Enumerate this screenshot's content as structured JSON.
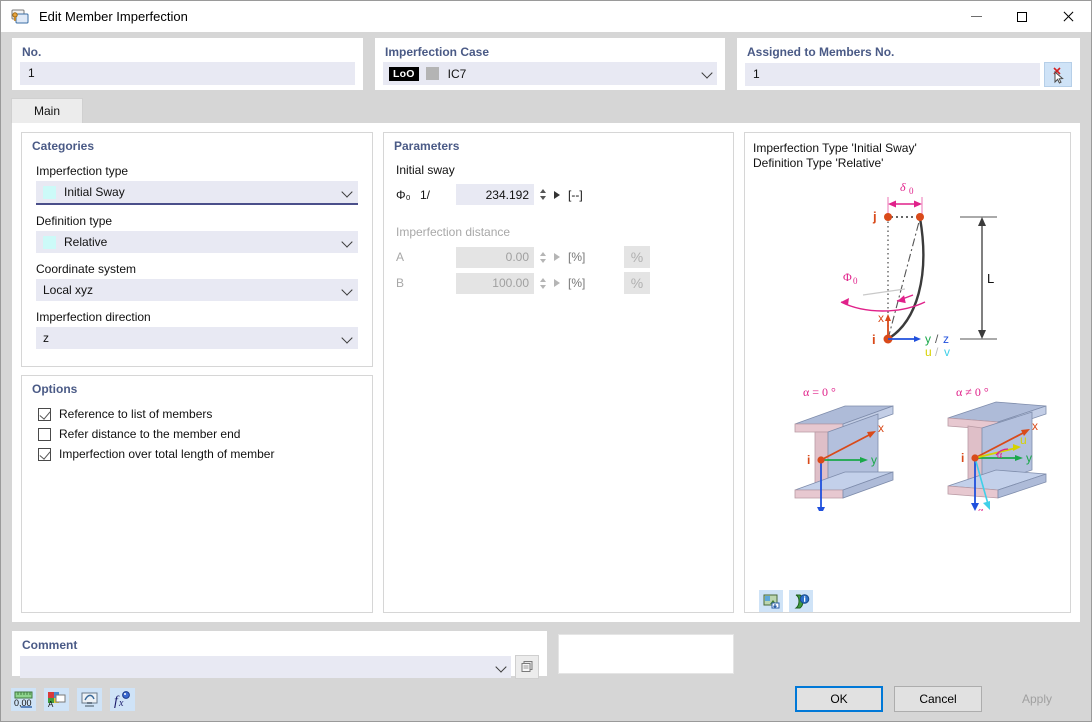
{
  "window": {
    "title": "Edit Member Imperfection",
    "icon": "member-imperfection-icon",
    "minimize": "minimize-icon",
    "maximize": "maximize-icon",
    "close": "close-icon"
  },
  "top": {
    "no": {
      "title": "No.",
      "value": "1"
    },
    "case": {
      "title": "Imperfection Case",
      "badge": "LoO",
      "swatch_color": "#b4b4b4",
      "value": "IC7"
    },
    "assigned": {
      "title": "Assigned to Members No.",
      "value": "1",
      "pick_button": "pick-members-icon"
    }
  },
  "tabs": [
    {
      "label": "Main",
      "active": true
    }
  ],
  "categories": {
    "title": "Categories",
    "fields": [
      {
        "label": "Imperfection type",
        "value": "Initial Sway",
        "swatch": "#ccfaf8",
        "has_swatch": true,
        "focused": true
      },
      {
        "label": "Definition type",
        "value": "Relative",
        "swatch": "#ccfaf8",
        "has_swatch": true,
        "focused": false
      },
      {
        "label": "Coordinate system",
        "value": "Local xyz",
        "has_swatch": false,
        "focused": false
      },
      {
        "label": "Imperfection direction",
        "value": "z",
        "has_swatch": false,
        "focused": false
      }
    ]
  },
  "options": {
    "title": "Options",
    "items": [
      {
        "label": "Reference to list of members",
        "checked": true
      },
      {
        "label": "Refer distance to the member end",
        "checked": false
      },
      {
        "label": "Imperfection over total length of member",
        "checked": true
      }
    ]
  },
  "parameters": {
    "title": "Parameters",
    "initial_sway": {
      "heading": "Initial sway",
      "symbol": "Φ₀",
      "prefix": "1/",
      "value": "234.192",
      "unit": "[--]",
      "enabled": true
    },
    "imperfection_distance": {
      "heading": "Imperfection distance",
      "enabled": false,
      "rows": [
        {
          "symbol": "A",
          "value": "0.00",
          "unit": "[%]",
          "button": "%"
        },
        {
          "symbol": "B",
          "value": "100.00",
          "unit": "[%]",
          "button": "%"
        }
      ]
    }
  },
  "diagram": {
    "caption_line1": "Imperfection Type 'Initial Sway'",
    "caption_line2": "Definition Type 'Relative'",
    "sway": {
      "delta_label": "δ₀",
      "phi_label": "Φ₀",
      "node_j": "j",
      "node_i": "i",
      "length_label": "L",
      "axis_x": "x",
      "axis_yz": "y / z",
      "axis_uv": "u / v"
    },
    "sections": [
      {
        "title": "α = 0 °",
        "axes": [
          "x",
          "y",
          "z"
        ]
      },
      {
        "title": "α ≠ 0 °",
        "axes": [
          "x",
          "y",
          "z",
          "u",
          "v",
          "α"
        ]
      }
    ],
    "buttons": [
      "image-export-icon",
      "info-icon"
    ]
  },
  "comment": {
    "title": "Comment",
    "value": "",
    "dropdown_icon": "chevron-down-icon",
    "copy_button": "comment-library-icon"
  },
  "footer": {
    "tools": [
      "units-icon",
      "display-properties-icon",
      "visibility-icon",
      "formula-icon"
    ],
    "ok": "OK",
    "cancel": "Cancel",
    "apply": "Apply",
    "apply_enabled": false
  }
}
